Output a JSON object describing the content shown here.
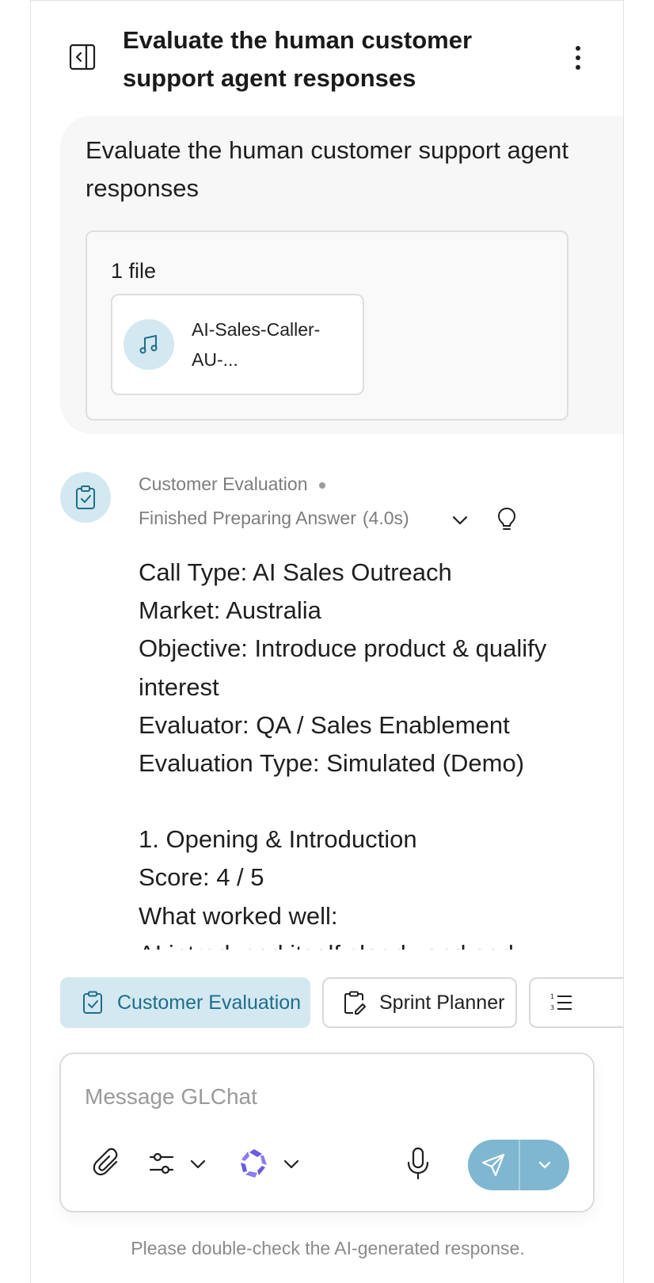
{
  "header": {
    "title": "Evaluate the human customer support agent responses",
    "sidebar_toggle_icon": "sidebar-collapse-icon",
    "menu_icon": "kebab-menu-icon"
  },
  "user_message": {
    "text": "Evaluate the human customer support agent responses",
    "files_count": "1 file",
    "file": {
      "name": "AI-Sales-Caller-AU-...",
      "icon": "music-note-icon"
    }
  },
  "assistant": {
    "agent_name": "Customer Evaluation",
    "status": "Finished Preparing Answer",
    "duration": "(4.0s)",
    "answer_lines": [
      "Call Type: AI Sales Outreach",
      "Market: Australia",
      "Objective: Introduce product & qualify interest",
      "Evaluator: QA / Sales Enablement",
      "Evaluation Type: Simulated (Demo)",
      "",
      "1. Opening & Introduction",
      "Score: 4 / 5",
      "What worked well:",
      "AI introduced itself clearly and early"
    ]
  },
  "chips": [
    {
      "label": "Customer Evaluation",
      "active": true,
      "icon": "clipboard-check-icon"
    },
    {
      "label": "Sprint Planner",
      "active": false,
      "icon": "clipboard-edit-icon"
    },
    {
      "label": "",
      "active": false,
      "icon": "list-ordered-icon"
    }
  ],
  "composer": {
    "placeholder": "Message GLChat",
    "value": ""
  },
  "disclaimer": "Please double-check the AI-generated response.",
  "colors": {
    "accent": "#7fb7d0",
    "accent_light": "#d3e8f0",
    "accent_text": "#1f6d8c",
    "model_logo": "#6a5be2"
  }
}
